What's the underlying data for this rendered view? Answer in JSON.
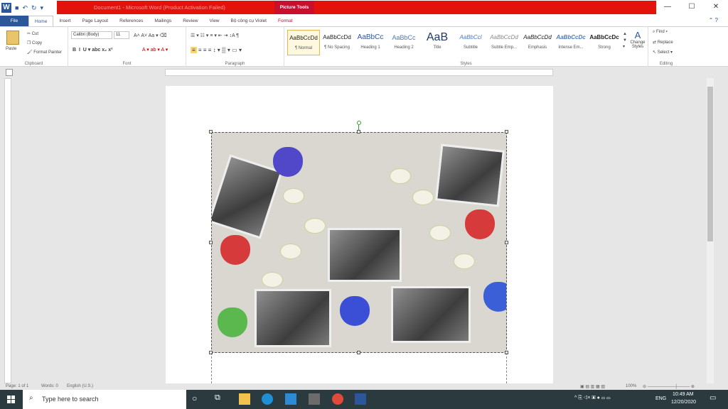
{
  "window": {
    "title": "Document1 - Microsoft Word (Product Activation Failed)",
    "picture_tools": "Picture Tools"
  },
  "tabs": [
    "File",
    "Home",
    "Insert",
    "Page Layout",
    "References",
    "Mailings",
    "Review",
    "View",
    "Bộ công cụ Violet",
    "Format"
  ],
  "clipboard": {
    "paste": "Paste",
    "cut": "Cut",
    "copy": "Copy",
    "format_painter": "Format Painter",
    "label": "Clipboard"
  },
  "font": {
    "name": "Calibri (Body)",
    "size": "11",
    "label": "Font"
  },
  "paragraph": {
    "label": "Paragraph"
  },
  "styles": {
    "label": "Styles",
    "items": [
      {
        "sample": "AaBbCcDd",
        "name": "¶ Normal"
      },
      {
        "sample": "AaBbCcDd",
        "name": "¶ No Spacing"
      },
      {
        "sample": "AaBbCc",
        "name": "Heading 1"
      },
      {
        "sample": "AaBbCc",
        "name": "Heading 2"
      },
      {
        "sample": "AaB",
        "name": "Title"
      },
      {
        "sample": "AaBbCcl",
        "name": "Subtitle"
      },
      {
        "sample": "AaBbCcDd",
        "name": "Subtle Emp..."
      },
      {
        "sample": "AaBbCcDd",
        "name": "Emphasis"
      },
      {
        "sample": "AaBbCcDc",
        "name": "Intense Em..."
      },
      {
        "sample": "AaBbCcDc",
        "name": "Strong"
      }
    ],
    "change_styles": "Change Styles"
  },
  "editing": {
    "find": "Find",
    "replace": "Replace",
    "select": "Select",
    "label": "Editing"
  },
  "status": {
    "page": "Page: 1 of 1",
    "words": "Words: 0",
    "lang": "English (U.S.)",
    "zoom": "100%"
  },
  "taskbar": {
    "search_placeholder": "Type here to search",
    "lang": "ENG",
    "time": "10:49 AM",
    "date": "12/20/2020"
  },
  "colors": {
    "word_blue": "#2b579a",
    "title_red": "#e3120b",
    "picture_tools_red": "#c8102e"
  }
}
